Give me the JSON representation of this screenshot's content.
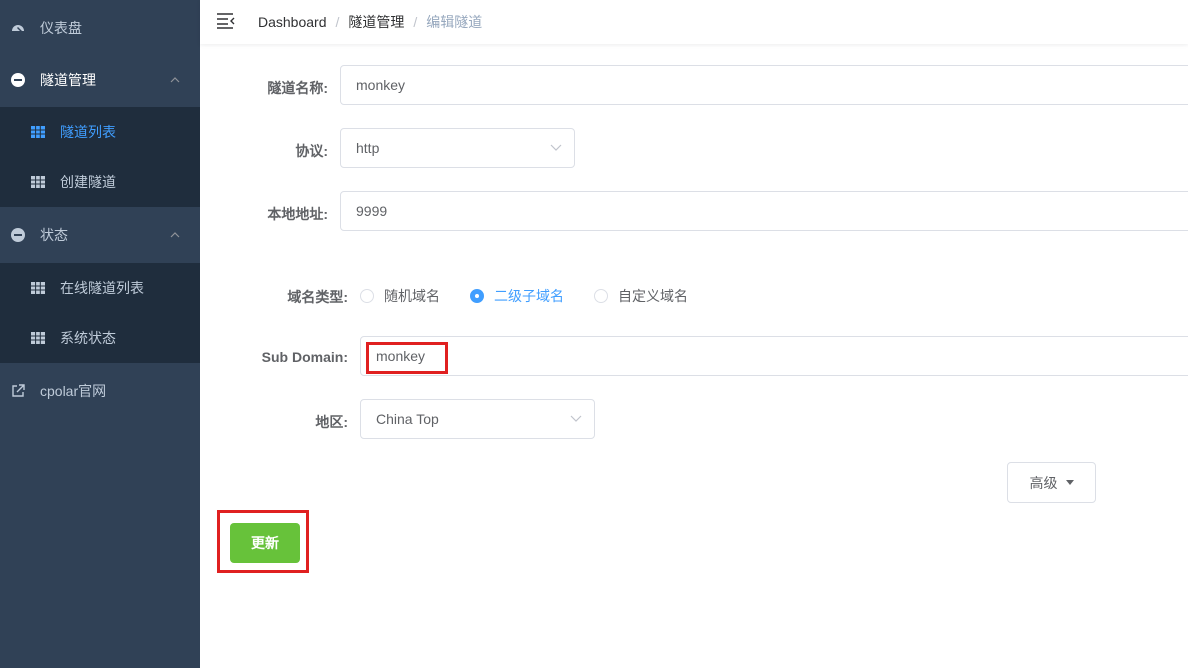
{
  "sidebar": {
    "items": [
      {
        "label": "仪表盘",
        "icon": "dashboard-icon"
      },
      {
        "label": "隧道管理",
        "icon": "tunnel-icon"
      },
      {
        "label": "隧道列表",
        "icon": "table-icon"
      },
      {
        "label": "创建隧道",
        "icon": "table-icon"
      },
      {
        "label": "状态",
        "icon": "status-icon"
      },
      {
        "label": "在线隧道列表",
        "icon": "table-icon"
      },
      {
        "label": "系统状态",
        "icon": "table-icon"
      },
      {
        "label": "cpolar官网",
        "icon": "external-link-icon"
      }
    ]
  },
  "breadcrumb": {
    "items": [
      "Dashboard",
      "隧道管理",
      "编辑隧道"
    ],
    "separator": "/"
  },
  "form": {
    "tunnel_name_label": "隧道名称:",
    "tunnel_name_value": "monkey",
    "protocol_label": "协议:",
    "protocol_value": "http",
    "local_addr_label": "本地地址:",
    "local_addr_value": "9999",
    "domain_type_label": "域名类型:",
    "domain_types": [
      "随机域名",
      "二级子域名",
      "自定义域名"
    ],
    "domain_type_selected": "二级子域名",
    "subdomain_label": "Sub Domain:",
    "subdomain_value": "monkey",
    "region_label": "地区:",
    "region_value": "China Top"
  },
  "buttons": {
    "advanced": "高级",
    "update": "更新"
  },
  "colors": {
    "sidebar_bg": "#304156",
    "submenu_bg": "#1f2d3d",
    "active": "#409eff",
    "update_button": "#67c23a",
    "highlight": "#e02020"
  }
}
